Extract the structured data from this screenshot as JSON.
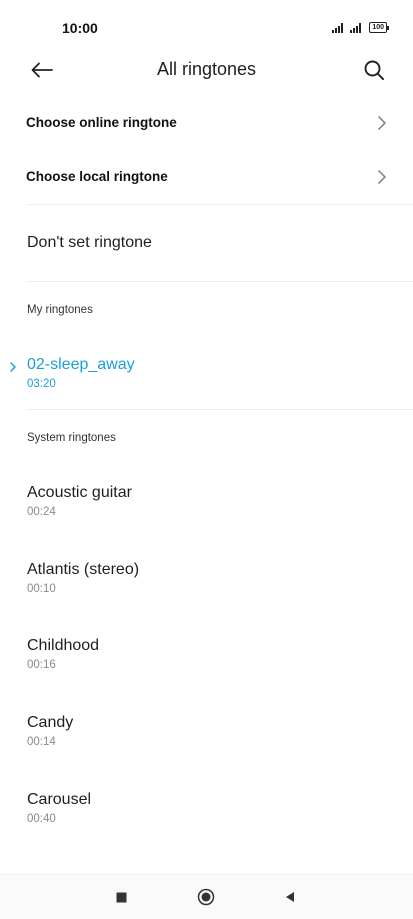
{
  "status_bar": {
    "time": "10:00",
    "battery": "100"
  },
  "header": {
    "title": "All ringtones"
  },
  "options": {
    "online_label": "Choose online ringtone",
    "local_label": "Choose local ringtone",
    "dont_set_label": "Don't set ringtone"
  },
  "my_ringtones": {
    "header": "My ringtones",
    "items": [
      {
        "name": "02-sleep_away",
        "duration": "03:20"
      }
    ]
  },
  "system_ringtones": {
    "header": "System ringtones",
    "items": [
      {
        "name": "Acoustic guitar",
        "duration": "00:24"
      },
      {
        "name": "Atlantis (stereo)",
        "duration": "00:10"
      },
      {
        "name": "Childhood",
        "duration": "00:16"
      },
      {
        "name": "Candy",
        "duration": "00:14"
      },
      {
        "name": "Carousel",
        "duration": "00:40"
      }
    ]
  },
  "colors": {
    "accent": "#1a9fd9",
    "text_primary": "#1f1f1f",
    "text_secondary": "#8a8a8a"
  },
  "icons": {
    "back": "arrow-left-icon",
    "search": "search-icon",
    "chevron": "chevron-right-icon",
    "selected": "chevron-right-icon",
    "nav_recents": "square-icon",
    "nav_home": "circle-icon",
    "nav_back": "triangle-left-icon"
  }
}
